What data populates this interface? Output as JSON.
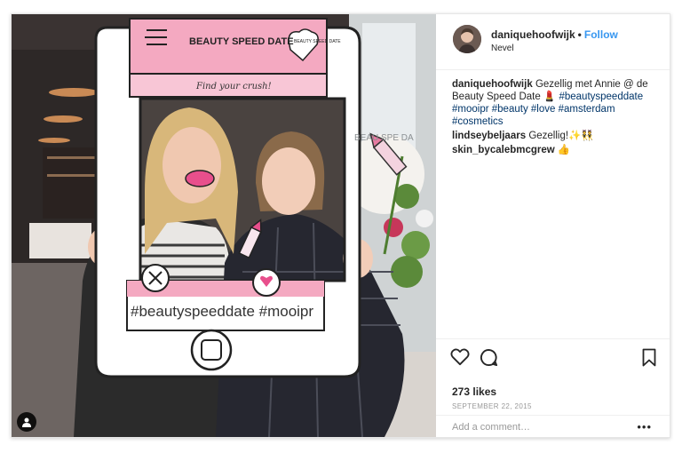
{
  "post": {
    "photo": {
      "frame_texts": {
        "brand": "BEAUTY SPEED DATE",
        "heart_text": "BEAUTY SPEED DATE",
        "tagline": "Find your crush!",
        "hashtags": "#beautyspeeddate  #mooipr",
        "side_sign": "BEAU SPE DA"
      },
      "user_tag_icon": "person-icon"
    },
    "header": {
      "username": "daniquehoofwijk",
      "dot": "•",
      "follow_label": "Follow",
      "location": "Nevel"
    },
    "caption": {
      "user": "daniquehoofwijk",
      "text": "Gezellig met Annie @ de Beauty Speed Date 💄",
      "hashtags": [
        "#beautyspeeddate",
        "#mooipr",
        "#beauty",
        "#love",
        "#amsterdam",
        "#cosmetics"
      ]
    },
    "comments": [
      {
        "user": "lindseybeljaars",
        "text": "Gezellig!✨👯"
      },
      {
        "user": "skin_bycalebmcgrew",
        "text": "👍"
      }
    ],
    "actions": {
      "like_icon": "heart-icon",
      "comment_icon": "comment-icon",
      "save_icon": "bookmark-icon"
    },
    "likes": "273 likes",
    "date": "SEPTEMBER 22, 2015",
    "add_comment_placeholder": "Add a comment…",
    "more_label": "•••"
  },
  "colors": {
    "link": "#3897f0",
    "hashtag": "#003569",
    "frame_pink": "#f4a9c1",
    "frame_pink_dark": "#e87aa1"
  }
}
